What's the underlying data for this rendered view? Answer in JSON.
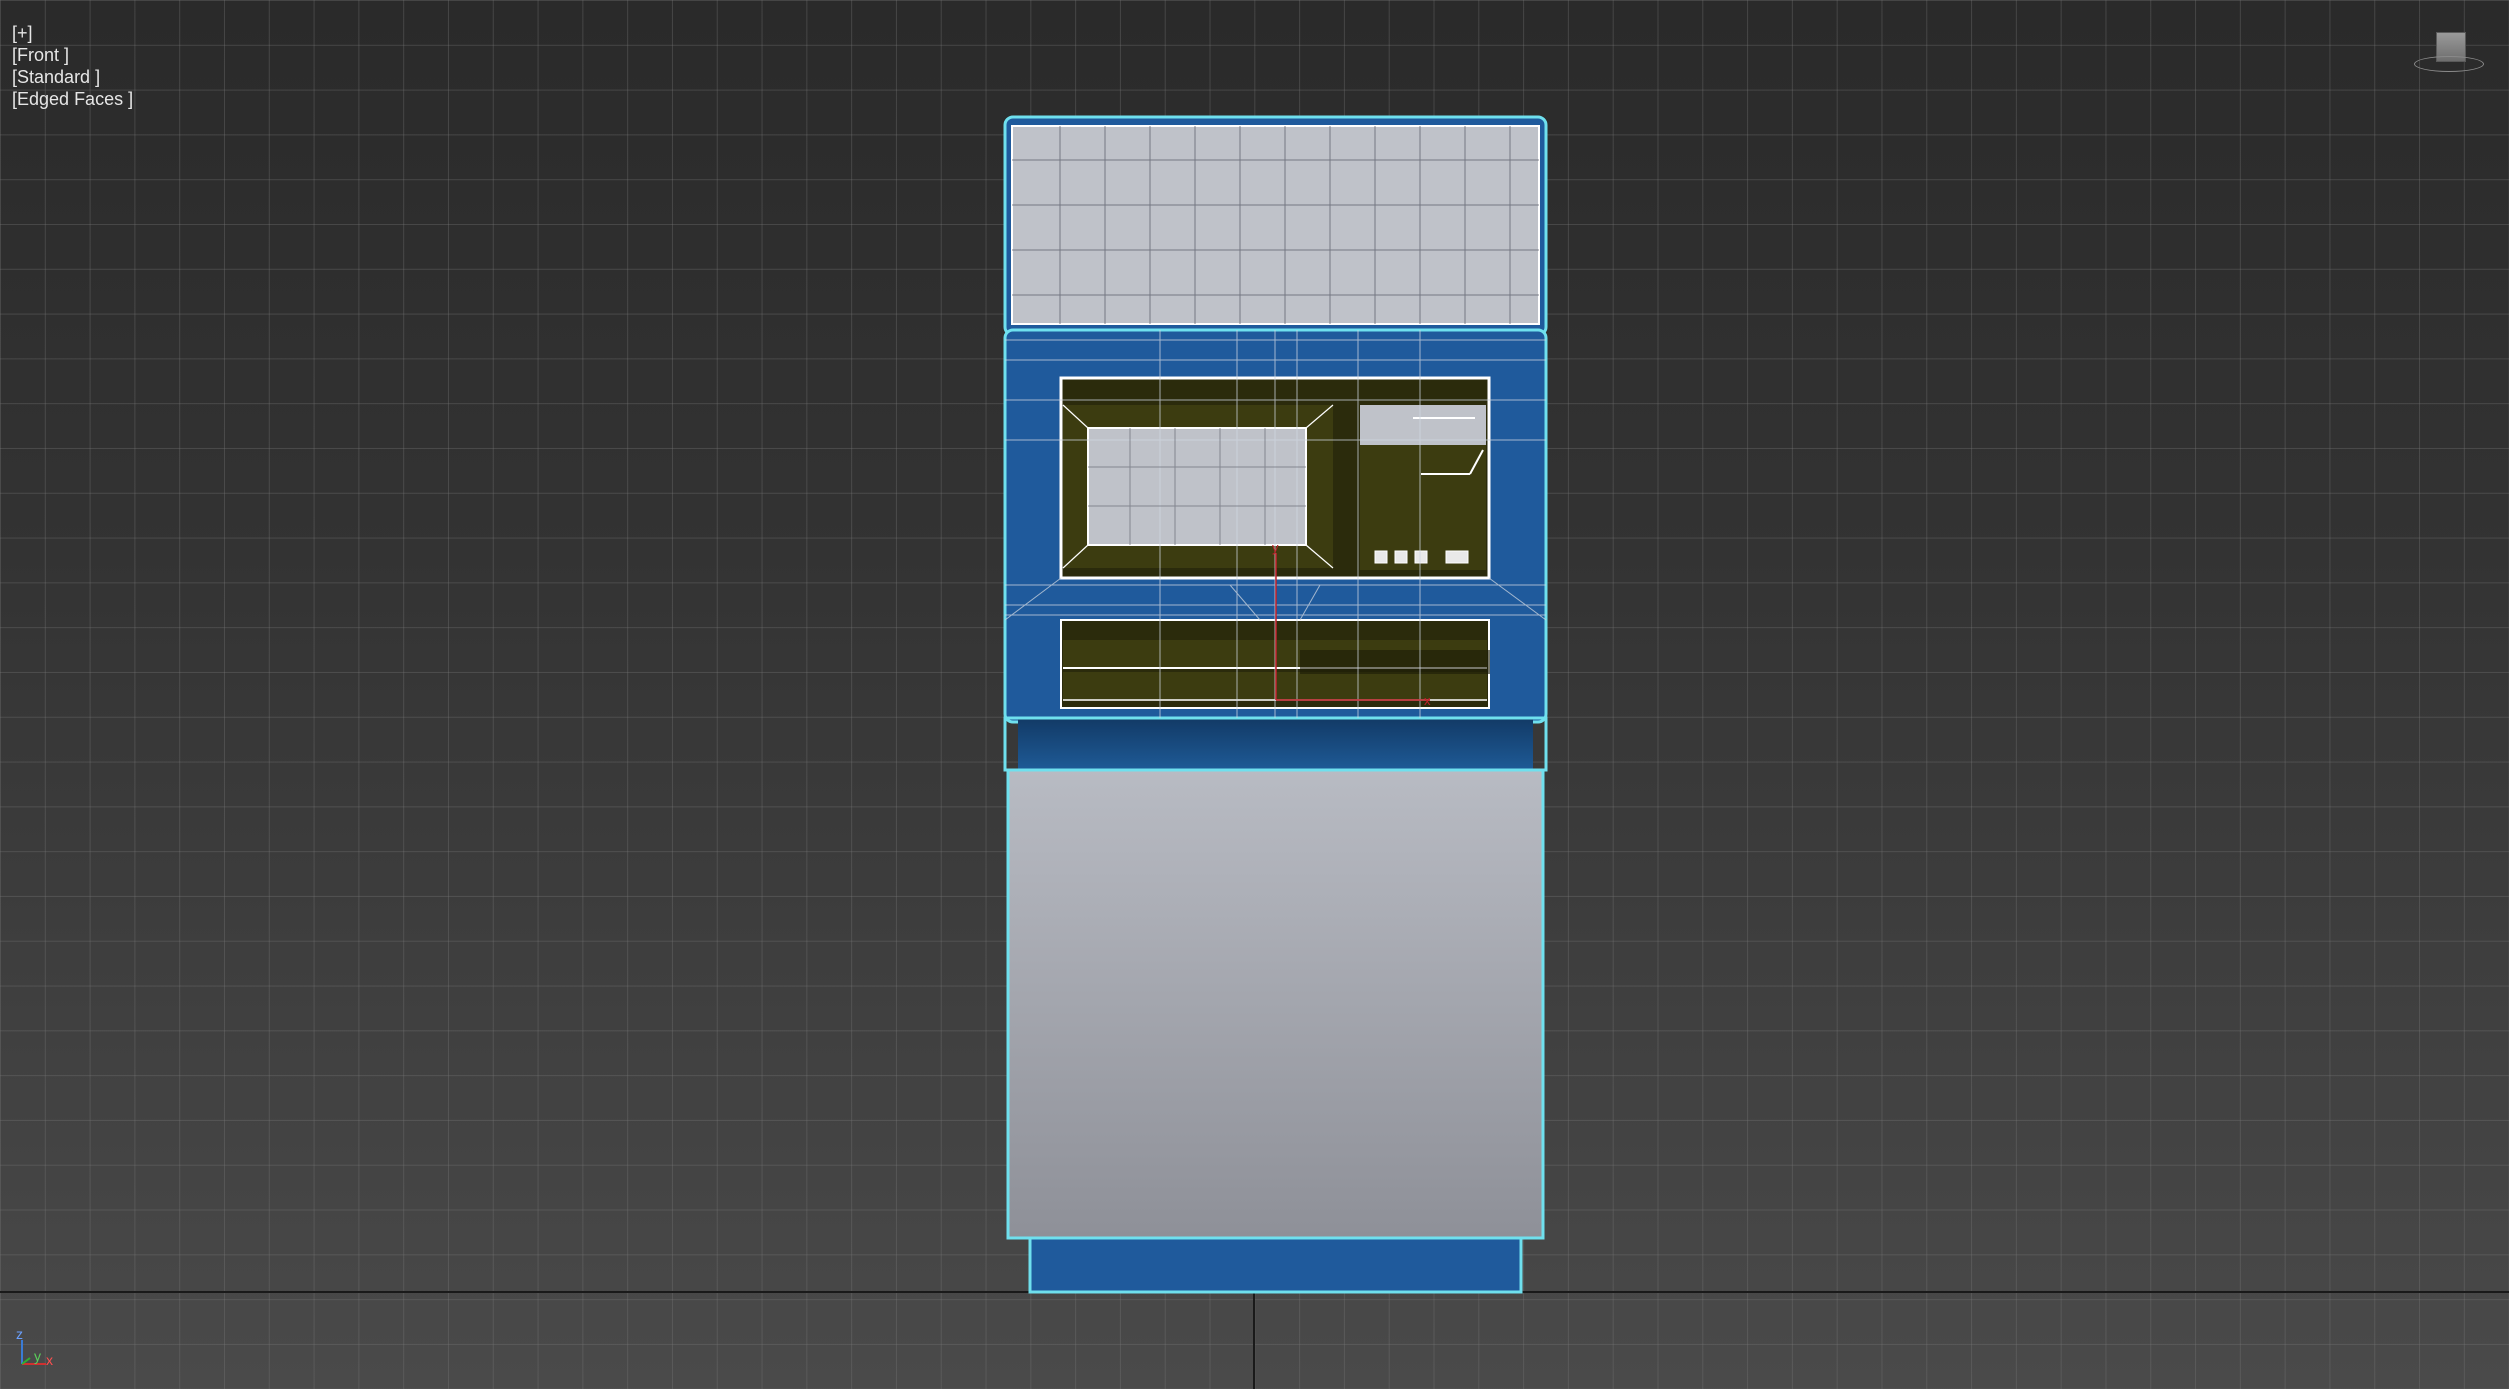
{
  "viewport": {
    "label_plus": "[+]",
    "label_view": "[Front ]",
    "label_shading": "[Standard ]",
    "label_mode": "[Edged Faces ]"
  },
  "axes": {
    "z": "z",
    "y": "y",
    "x": "x"
  },
  "colors": {
    "selection": "#6fe0ee",
    "body_blue": "#1f5a9c",
    "panel_gray": "#b9bcc4",
    "screen_olive": "#3c3c10",
    "grid_line": "#787878"
  }
}
